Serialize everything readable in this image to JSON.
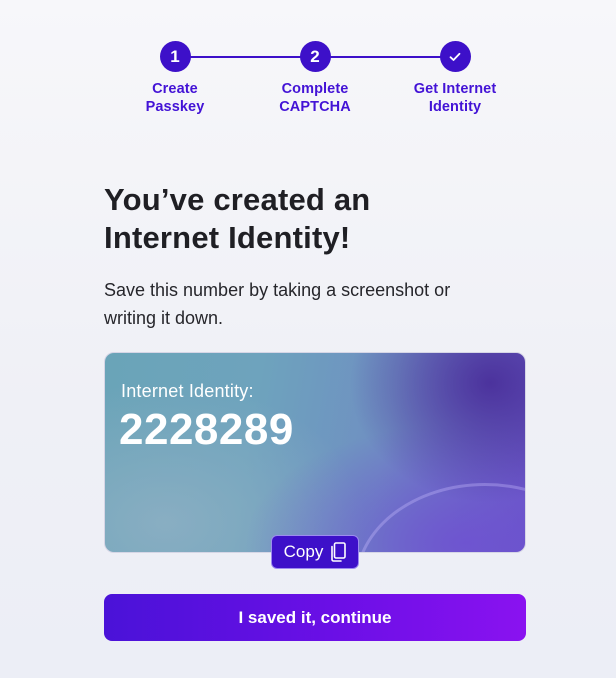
{
  "stepper": {
    "steps": [
      {
        "marker": "1",
        "label_line1": "Create",
        "label_line2": "Passkey"
      },
      {
        "marker": "2",
        "label_line1": "Complete",
        "label_line2": "CAPTCHA"
      },
      {
        "marker": "✓",
        "label_line1": "Get Internet",
        "label_line2": "Identity"
      }
    ],
    "accent_color": "#3d10c9"
  },
  "heading": {
    "line1": "You’ve created an",
    "line2": "Internet Identity!"
  },
  "description": {
    "line1": "Save this number by taking a screenshot or",
    "line2": "writing it down."
  },
  "identity_card": {
    "label": "Internet Identity:",
    "number": "2228289"
  },
  "copy_button": {
    "label": "Copy",
    "icon": "copy-icon"
  },
  "continue_button": {
    "label": "I saved it, continue"
  }
}
